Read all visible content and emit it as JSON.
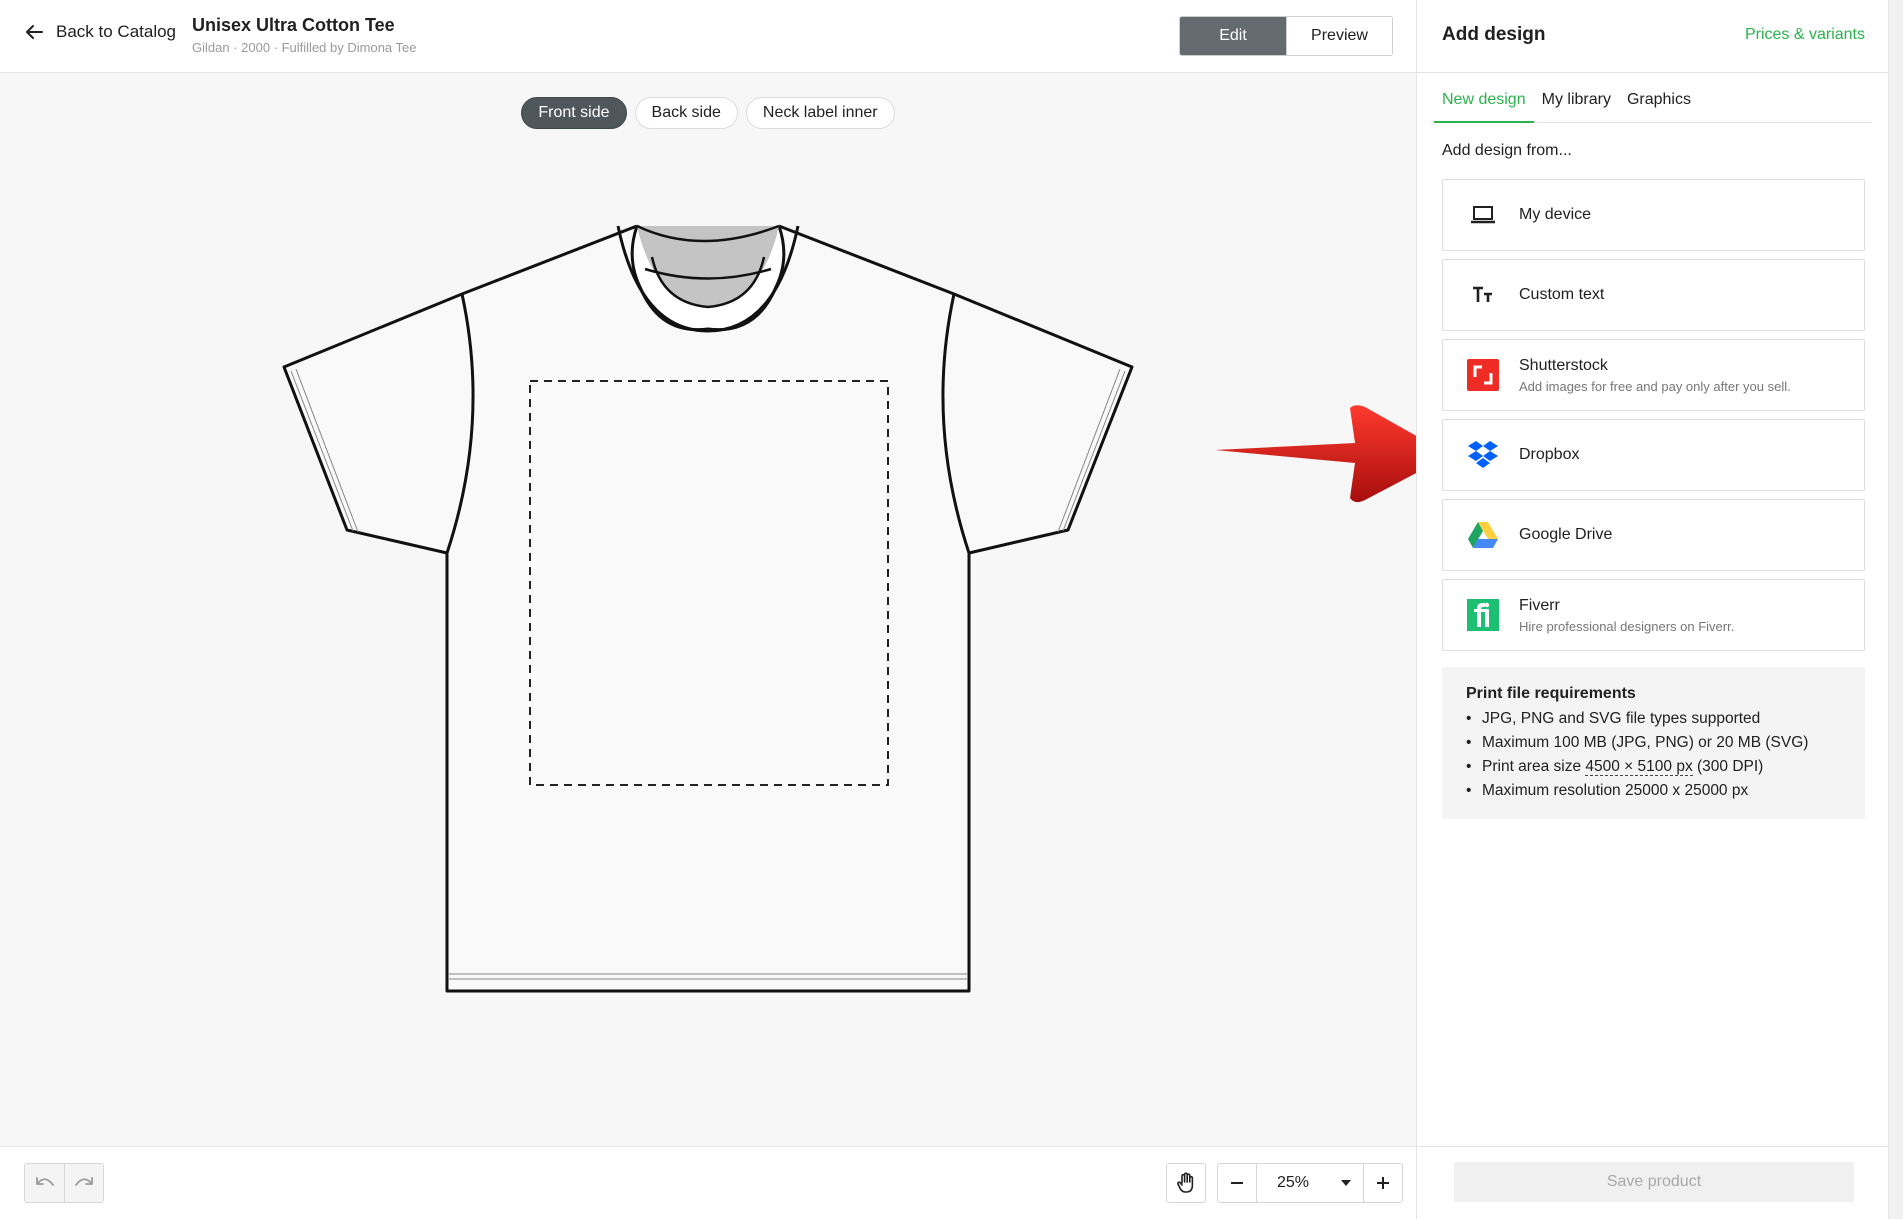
{
  "header": {
    "back_label": "Back to Catalog",
    "product_title": "Unisex Ultra Cotton Tee",
    "product_subtitle": "Gildan · 2000 · Fulfilled by Dimona Tee",
    "edit_label": "Edit",
    "preview_label": "Preview"
  },
  "canvas": {
    "sides": [
      {
        "label": "Front side",
        "active": true
      },
      {
        "label": "Back side",
        "active": false
      },
      {
        "label": "Neck label inner",
        "active": false
      }
    ]
  },
  "toolbar": {
    "zoom_value": "25%"
  },
  "panel": {
    "title": "Add design",
    "prices_link": "Prices & variants",
    "tabs": [
      "New design",
      "My library",
      "Graphics"
    ],
    "from_label": "Add design from...",
    "sources": [
      {
        "name": "My device",
        "desc": "",
        "icon": "laptop-icon"
      },
      {
        "name": "Custom text",
        "desc": "",
        "icon": "text-icon"
      },
      {
        "name": "Shutterstock",
        "desc": "Add images for free and pay only after you sell.",
        "icon": "shutterstock-icon"
      },
      {
        "name": "Dropbox",
        "desc": "",
        "icon": "dropbox-icon"
      },
      {
        "name": "Google Drive",
        "desc": "",
        "icon": "google-drive-icon"
      },
      {
        "name": "Fiverr",
        "desc": "Hire professional designers on Fiverr.",
        "icon": "fiverr-icon"
      }
    ],
    "requirements": {
      "title": "Print file requirements",
      "items": [
        "JPG, PNG and SVG file types supported",
        "Maximum 100 MB (JPG, PNG) or 20 MB (SVG)"
      ],
      "print_area_prefix": "Print area size ",
      "print_area_size": "4500 × 5100 px",
      "print_area_suffix": " (300 DPI)",
      "max_resolution": "Maximum resolution 25000 x 25000 px"
    },
    "save_label": "Save product"
  },
  "colors": {
    "accent": "#2bb24c",
    "shutterstock": "#ee2b24",
    "dropbox": "#0061fe",
    "fiverr": "#1dbf73",
    "arrow": "#d81e1e"
  }
}
